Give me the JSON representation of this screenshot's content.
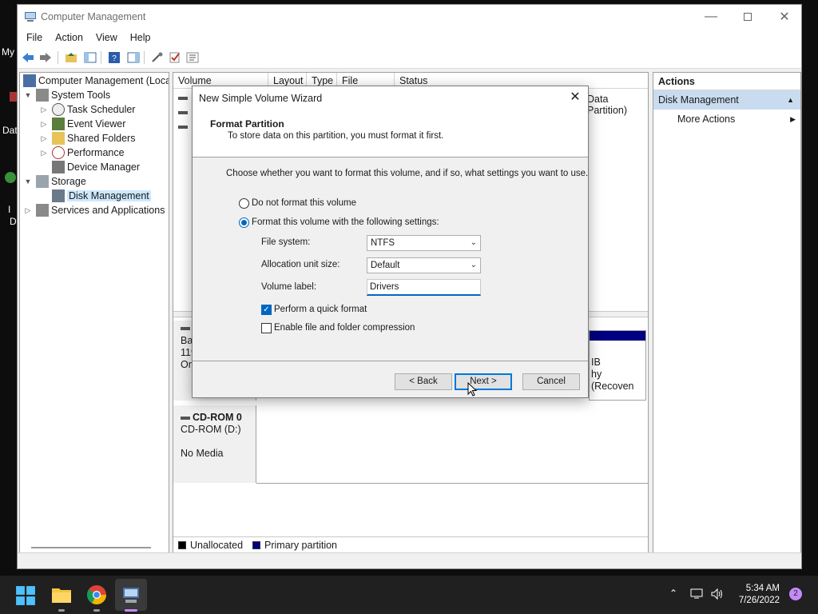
{
  "desktop": {
    "fragments": [
      "My",
      "Dat",
      "I",
      "D"
    ]
  },
  "window": {
    "title": "Computer Management",
    "menu": [
      "File",
      "Action",
      "View",
      "Help"
    ]
  },
  "tree": {
    "items": [
      {
        "label": "Computer Management (Local"
      },
      {
        "label": "System Tools"
      },
      {
        "label": "Task Scheduler"
      },
      {
        "label": "Event Viewer"
      },
      {
        "label": "Shared Folders"
      },
      {
        "label": "Performance"
      },
      {
        "label": "Device Manager"
      },
      {
        "label": "Storage"
      },
      {
        "label": "Disk Management"
      },
      {
        "label": "Services and Applications"
      }
    ]
  },
  "center": {
    "columns": [
      "Volume",
      "Layout",
      "Type",
      "File System",
      "Status"
    ],
    "row_fragment": "Data Partition)",
    "disk1": {
      "lines": [
        "Bas",
        "119",
        "On"
      ],
      "right_lines": [
        "IB",
        "hy (Recoven"
      ]
    },
    "cdrom": {
      "name": "CD-ROM 0",
      "drive": "CD-ROM (D:)",
      "media": "No Media"
    },
    "legend": [
      {
        "label": "Unallocated",
        "color": "#000000"
      },
      {
        "label": "Primary partition",
        "color": "#000080"
      }
    ]
  },
  "actions": {
    "header": "Actions",
    "section": "Disk Management",
    "items": [
      "More Actions"
    ]
  },
  "wizard": {
    "title": "New Simple Volume Wizard",
    "heading": "Format Partition",
    "subheading": "To store data on this partition, you must format it first.",
    "instruction": "Choose whether you want to format this volume, and if so, what settings you want to use.",
    "option_no_format": "Do not format this volume",
    "option_format": "Format this volume with the following settings:",
    "file_system_label": "File system:",
    "file_system_value": "NTFS",
    "alloc_label": "Allocation unit size:",
    "alloc_value": "Default",
    "volume_label_label": "Volume label:",
    "volume_label_value": "Drivers",
    "quick_format": "Perform a quick format",
    "compression": "Enable file and folder compression",
    "buttons": {
      "back": "< Back",
      "next": "Next >",
      "cancel": "Cancel"
    }
  },
  "taskbar": {
    "time": "5:34 AM",
    "date": "7/26/2022",
    "notifications": "2"
  }
}
